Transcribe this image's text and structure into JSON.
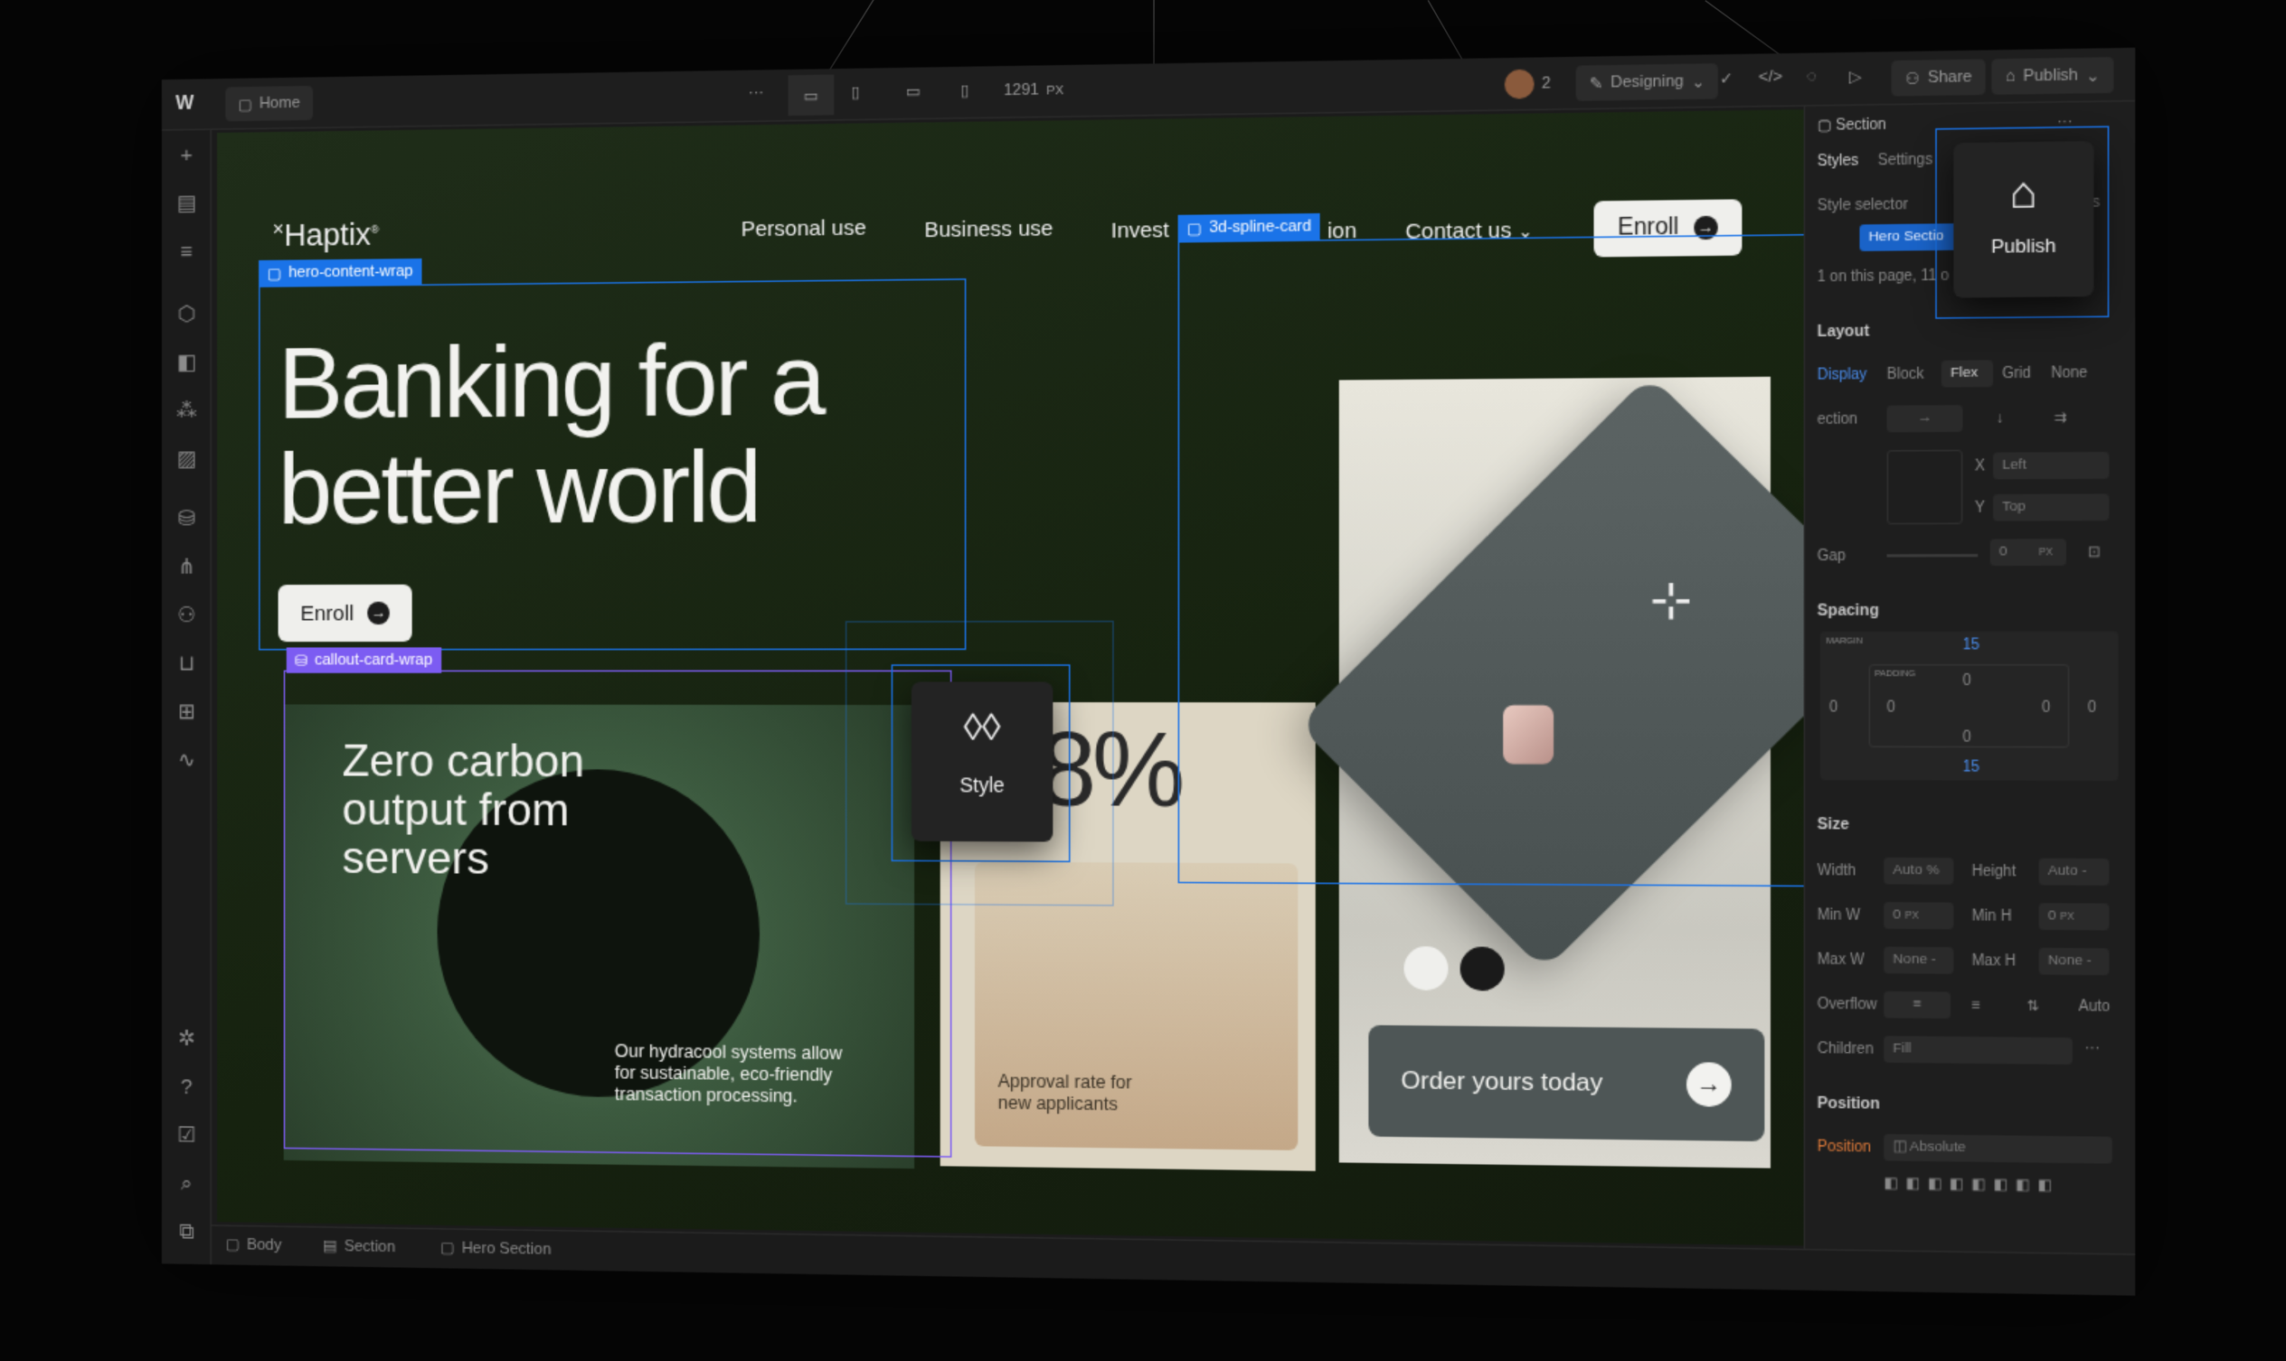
{
  "topbar": {
    "page": "Home",
    "more": "···",
    "width_value": "1291",
    "width_unit": "PX",
    "collaborators": "2",
    "mode": "Designing",
    "share": "Share",
    "publish": "Publish"
  },
  "site": {
    "logo": "Haptix",
    "nav": [
      "Personal use",
      "Business use",
      "Invest",
      "ion",
      "Contact us"
    ],
    "enroll": "Enroll",
    "headline_1": "Banking for a",
    "headline_2": "better world",
    "hero_enroll": "Enroll",
    "card1_title_1": "Zero carbon",
    "card1_title_2": "output from",
    "card1_title_3": "servers",
    "card1_body_1": "Our hydracool systems allow",
    "card1_body_2": "for sustainable, eco-friendly",
    "card1_body_3": "transaction processing.",
    "stat": "8%",
    "stat_caption_1": "Approval rate for",
    "stat_caption_2": "new applicants",
    "order": "Order yours today"
  },
  "labels": {
    "hero_wrap": "hero-content-wrap",
    "callout_wrap": "callout-card-wrap",
    "spline": "3d-spline-card",
    "style_popup": "Style",
    "publish_popup": "Publish"
  },
  "breadcrumbs": [
    "Body",
    "Section",
    "Hero Section"
  ],
  "panel": {
    "element": "Section",
    "tab_styles": "Styles",
    "tab_settings": "Settings",
    "style_selector": "Style selector",
    "selector_value": "Hero Sectio",
    "on_page": "1 on this page, 11 o",
    "ors": "ors",
    "layout": "Layout",
    "display": "Display",
    "display_opts": [
      "Block",
      "Flex",
      "Grid",
      "None"
    ],
    "direction": "ection",
    "align_x_label": "X",
    "align_x": "Left",
    "align_y_label": "Y",
    "align_y": "Top",
    "gap": "Gap",
    "gap_value": "0",
    "gap_unit": "PX",
    "spacing": "Spacing",
    "margin": "MARGIN",
    "padding": "PADDING",
    "margin_top": "15",
    "margin_bottom": "15",
    "margin_left": "0",
    "margin_right": "0",
    "padding_top": "0",
    "padding_bottom": "0",
    "padding_left": "0",
    "padding_right": "0",
    "size": "Size",
    "width": "Width",
    "width_val": "Auto",
    "width_unit": "%",
    "height": "Height",
    "height_val": "Auto",
    "minw": "Min W",
    "minw_val": "0",
    "minh": "Min H",
    "minh_val": "0",
    "px": "PX",
    "maxw": "Max W",
    "maxw_val": "None",
    "maxh": "Max H",
    "maxh_val": "None",
    "overflow": "Overflow",
    "overflow_auto": "Auto",
    "children": "Children",
    "children_val": "Fill",
    "position": "Position",
    "position_label": "Position",
    "position_val": "Absolute",
    "dash": "-"
  }
}
